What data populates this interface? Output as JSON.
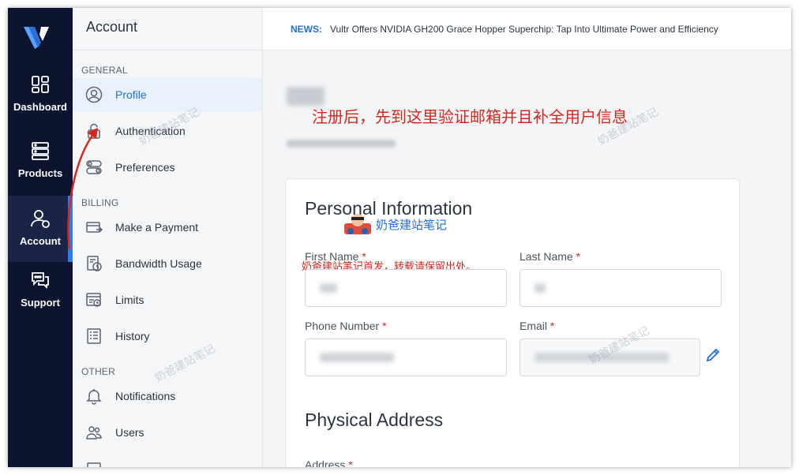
{
  "rail": {
    "items": [
      {
        "label": "Dashboard",
        "icon": "dashboard-icon"
      },
      {
        "label": "Products",
        "icon": "products-icon"
      },
      {
        "label": "Account",
        "icon": "account-icon"
      },
      {
        "label": "Support",
        "icon": "support-icon"
      }
    ],
    "active": "Account"
  },
  "sidebar": {
    "title": "Account",
    "sections": {
      "general": "GENERAL",
      "billing": "BILLING",
      "other": "OTHER"
    },
    "items": [
      {
        "label": "Profile",
        "icon": "user-circle-icon"
      },
      {
        "label": "Authentication",
        "icon": "lock-icon"
      },
      {
        "label": "Preferences",
        "icon": "toggles-icon"
      },
      {
        "label": "Make a Payment",
        "icon": "card-icon"
      },
      {
        "label": "Bandwidth Usage",
        "icon": "bandwidth-icon"
      },
      {
        "label": "Limits",
        "icon": "limits-icon"
      },
      {
        "label": "History",
        "icon": "history-icon"
      },
      {
        "label": "Notifications",
        "icon": "bell-icon"
      },
      {
        "label": "Users",
        "icon": "users-icon"
      }
    ]
  },
  "news": {
    "label": "NEWS:",
    "text": "Vultr Offers NVIDIA GH200 Grace Hopper Superchip: Tap Into Ultimate Power and Efficiency"
  },
  "profile": {
    "annotation": "注册后，先到这里验证邮箱并且补全用户信息"
  },
  "personal": {
    "title": "Personal Information",
    "first_name_label": "First Name",
    "last_name_label": "Last Name",
    "phone_label": "Phone Number",
    "email_label": "Email",
    "required_mark": "*"
  },
  "watermark": {
    "brand": "奶爸建站笔记",
    "note": "奶爸建站笔记首发，转载请保留出处。"
  },
  "address": {
    "title": "Physical Address",
    "address_label": "Address"
  },
  "colors": {
    "rail_bg": "#0c1430",
    "accent": "#1e6fe0",
    "required": "#d6271e"
  }
}
